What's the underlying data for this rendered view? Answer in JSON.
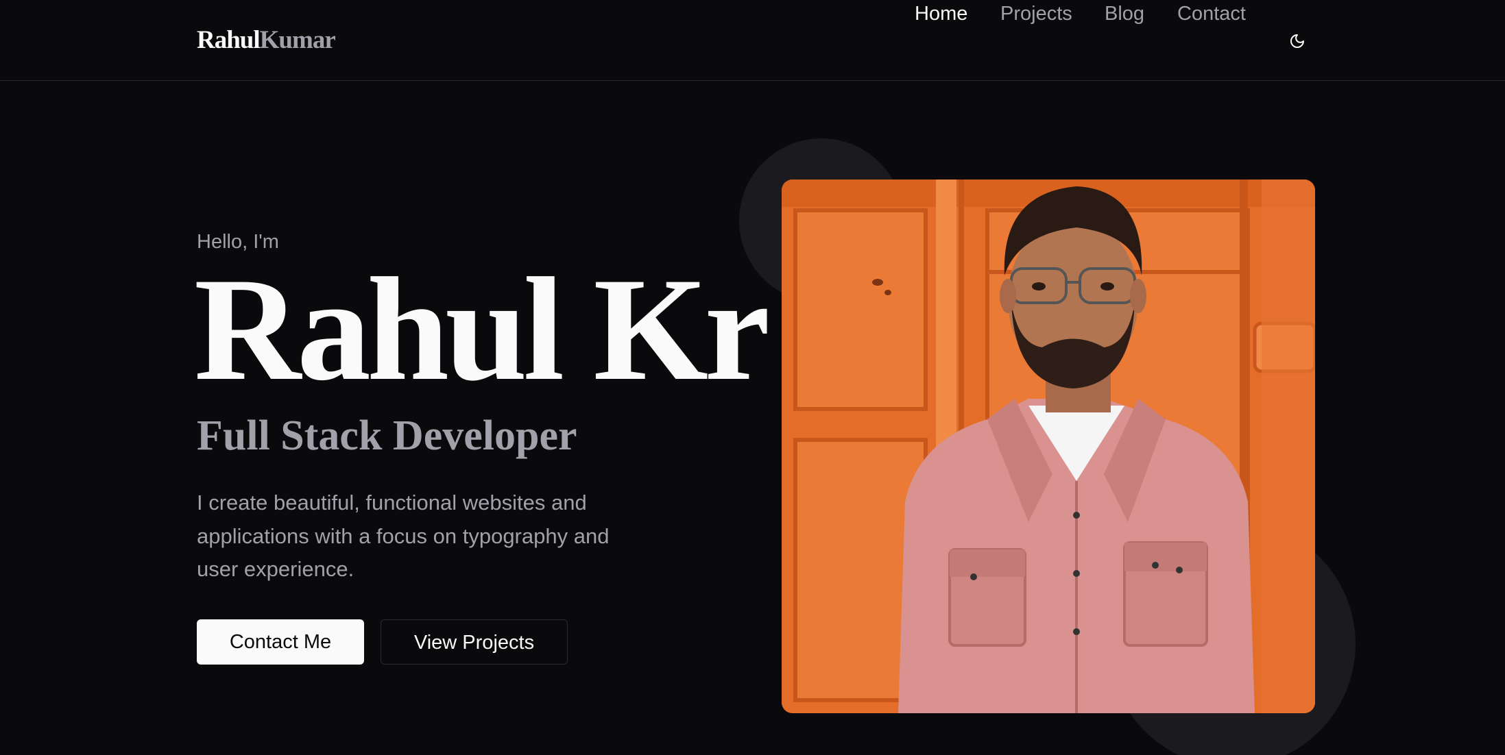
{
  "nav": {
    "logo_first": "Rahul",
    "logo_last": "Kumar",
    "links": [
      {
        "label": "Home",
        "active": true
      },
      {
        "label": "Projects",
        "active": false
      },
      {
        "label": "Blog",
        "active": false
      },
      {
        "label": "Contact",
        "active": false
      }
    ],
    "theme_toggle_icon": "moon-icon"
  },
  "hero": {
    "greeting": "Hello, I'm",
    "name": "Rahul Kr",
    "role": "Full Stack Developer",
    "bio": "I create beautiful, functional websites and applications with a focus on typography and user experience.",
    "primary_button": "Contact Me",
    "secondary_button": "View Projects"
  },
  "colors": {
    "background": "#0a0a0c",
    "foreground": "#fafafa",
    "muted": "#a1a1aa",
    "accent_photo": "#e6722e"
  }
}
